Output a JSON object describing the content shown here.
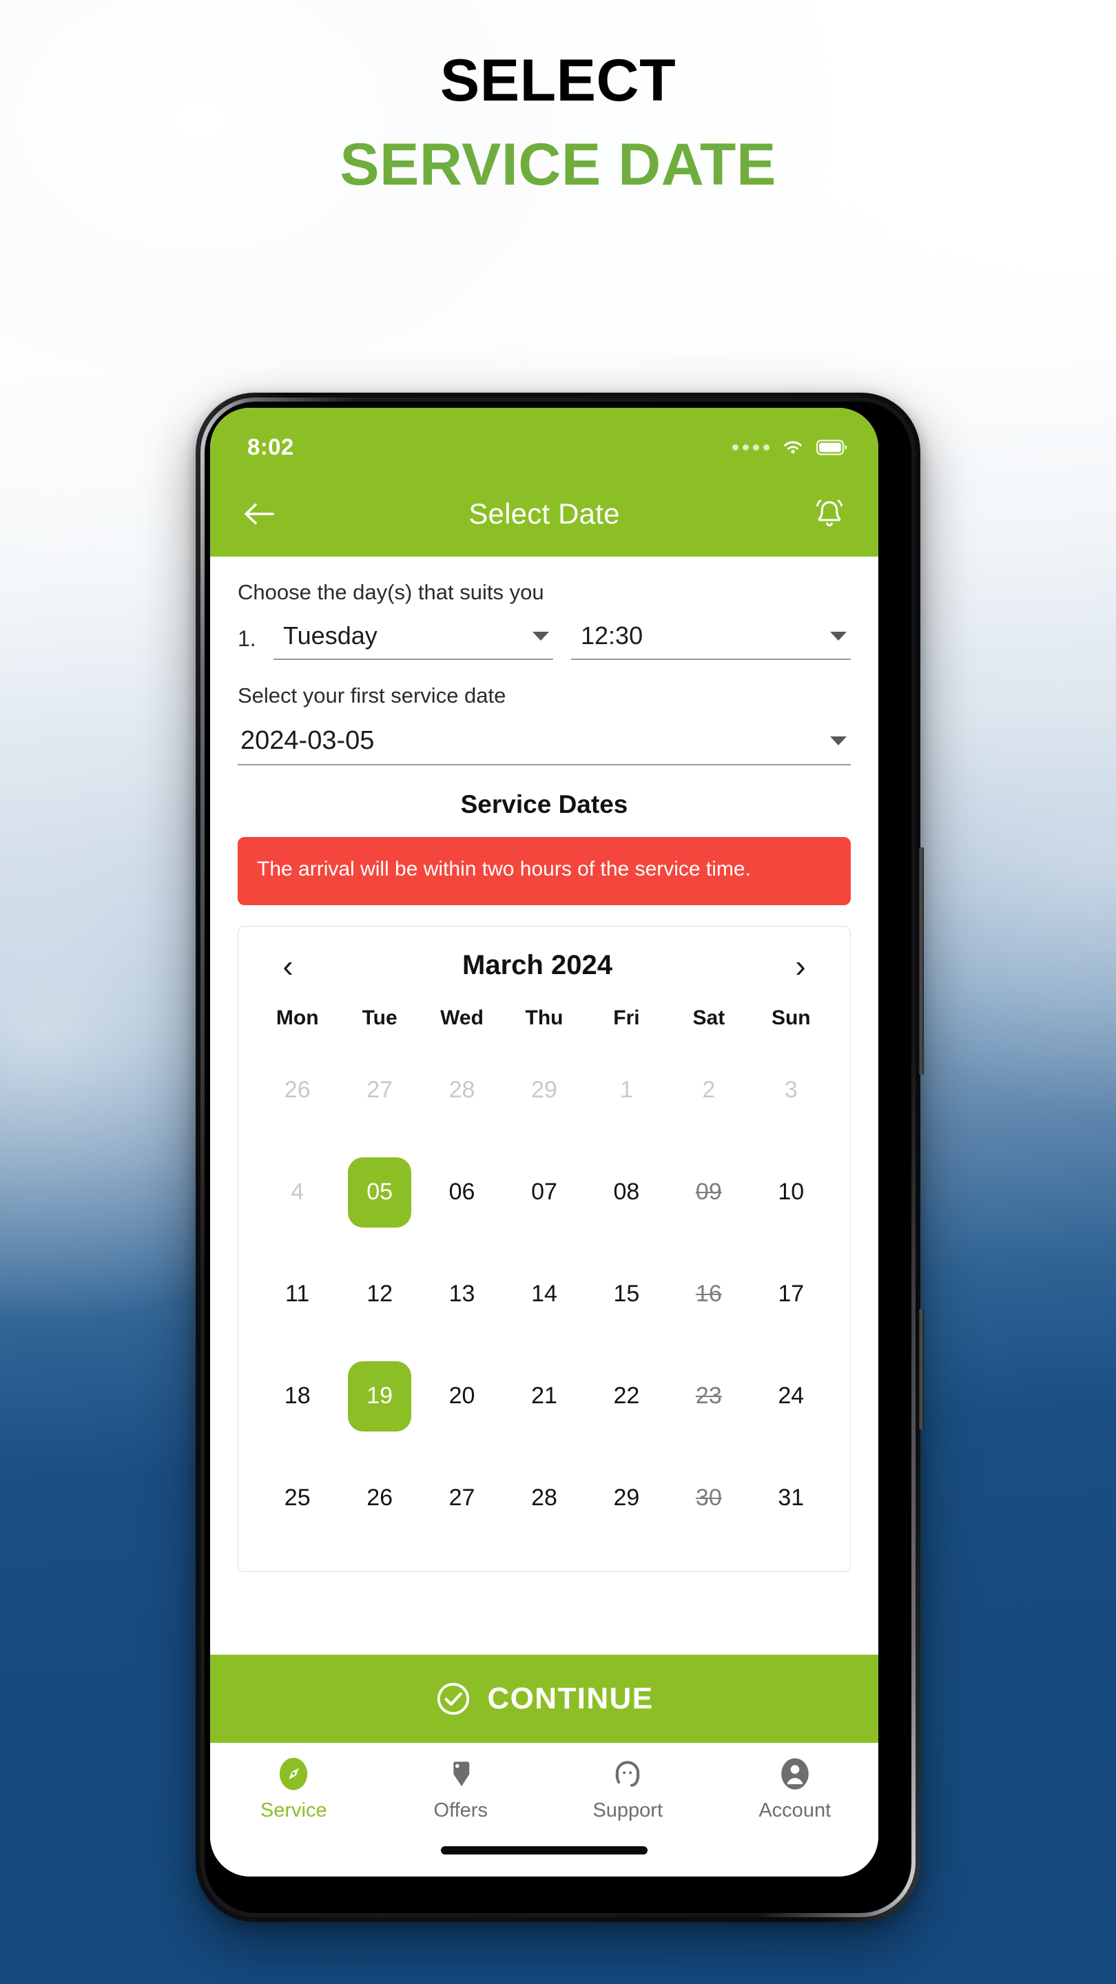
{
  "promo": {
    "line1": "SELECT",
    "line2": "SERVICE DATE",
    "line1_color": "#000000",
    "line2_color": "#6FAE3E"
  },
  "theme": {
    "brand_green": "#8CBF26",
    "alert_red": "#F4463C",
    "background_blue": "#154A80"
  },
  "status_bar": {
    "time": "8:02",
    "signal_icon": "signal-dots-icon",
    "wifi_icon": "wifi-icon",
    "battery_icon": "battery-full-icon"
  },
  "app_bar": {
    "back_icon": "back-arrow-icon",
    "title": "Select Date",
    "notification_icon": "bell-icon"
  },
  "form": {
    "day_prompt": "Choose the day(s) that suits you",
    "row_index": "1.",
    "day_value": "Tuesday",
    "time_value": "12:30",
    "first_date_prompt": "Select your first service date",
    "first_date_value": "2024-03-05",
    "dropdown_icon": "chevron-down-icon"
  },
  "service_dates_title": "Service Dates",
  "alert": {
    "text": "The arrival will be within two hours of the service time."
  },
  "calendar": {
    "prev_icon": "chevron-left-icon",
    "next_icon": "chevron-right-icon",
    "month_label": "March 2024",
    "day_names": [
      "Mon",
      "Tue",
      "Wed",
      "Thu",
      "Fri",
      "Sat",
      "Sun"
    ],
    "weeks": [
      [
        {
          "label": "26",
          "state": "muted"
        },
        {
          "label": "27",
          "state": "muted"
        },
        {
          "label": "28",
          "state": "muted"
        },
        {
          "label": "29",
          "state": "muted"
        },
        {
          "label": "1",
          "state": "muted"
        },
        {
          "label": "2",
          "state": "muted"
        },
        {
          "label": "3",
          "state": "muted"
        }
      ],
      [
        {
          "label": "4",
          "state": "muted"
        },
        {
          "label": "05",
          "state": "selected"
        },
        {
          "label": "06",
          "state": "normal"
        },
        {
          "label": "07",
          "state": "normal"
        },
        {
          "label": "08",
          "state": "normal"
        },
        {
          "label": "09",
          "state": "struck"
        },
        {
          "label": "10",
          "state": "normal"
        }
      ],
      [
        {
          "label": "11",
          "state": "normal"
        },
        {
          "label": "12",
          "state": "normal"
        },
        {
          "label": "13",
          "state": "normal"
        },
        {
          "label": "14",
          "state": "normal"
        },
        {
          "label": "15",
          "state": "normal"
        },
        {
          "label": "16",
          "state": "struck"
        },
        {
          "label": "17",
          "state": "normal"
        }
      ],
      [
        {
          "label": "18",
          "state": "normal"
        },
        {
          "label": "19",
          "state": "selected"
        },
        {
          "label": "20",
          "state": "normal"
        },
        {
          "label": "21",
          "state": "normal"
        },
        {
          "label": "22",
          "state": "normal"
        },
        {
          "label": "23",
          "state": "struck"
        },
        {
          "label": "24",
          "state": "normal"
        }
      ],
      [
        {
          "label": "25",
          "state": "normal"
        },
        {
          "label": "26",
          "state": "normal"
        },
        {
          "label": "27",
          "state": "normal"
        },
        {
          "label": "28",
          "state": "normal"
        },
        {
          "label": "29",
          "state": "normal"
        },
        {
          "label": "30",
          "state": "struck"
        },
        {
          "label": "31",
          "state": "normal"
        }
      ]
    ]
  },
  "continue_button": {
    "label": "CONTINUE",
    "icon": "check-circle-icon"
  },
  "bottom_nav": {
    "items": [
      {
        "label": "Service",
        "icon": "compass-icon",
        "active": true
      },
      {
        "label": "Offers",
        "icon": "tag-icon",
        "active": false
      },
      {
        "label": "Support",
        "icon": "headset-icon",
        "active": false
      },
      {
        "label": "Account",
        "icon": "account-person-icon",
        "active": false
      }
    ]
  }
}
